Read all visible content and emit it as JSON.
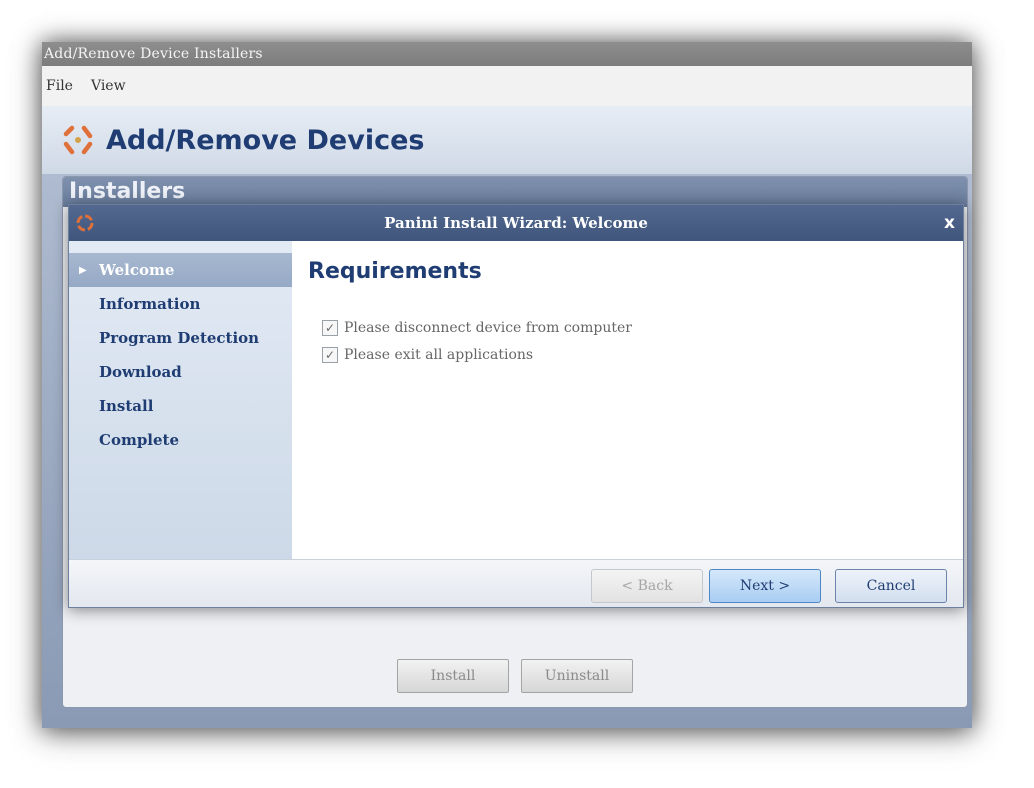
{
  "app": {
    "window_title": "Add/Remove Device Installers",
    "menu": [
      "File",
      "View"
    ],
    "header_title": "Add/Remove Devices",
    "panel_title": "Installers",
    "footer_buttons": {
      "install": "Install",
      "uninstall": "Uninstall"
    }
  },
  "wizard": {
    "title": "Panini Install Wizard: Welcome",
    "close_label": "x",
    "steps": [
      {
        "label": "Welcome",
        "active": true
      },
      {
        "label": "Information"
      },
      {
        "label": "Program Detection"
      },
      {
        "label": "Download"
      },
      {
        "label": "Install"
      },
      {
        "label": "Complete"
      }
    ],
    "content": {
      "heading": "Requirements",
      "requirements": [
        {
          "label": "Please disconnect device from computer",
          "checked": true
        },
        {
          "label": "Please exit all applications",
          "checked": true
        }
      ]
    },
    "buttons": {
      "back": "< Back",
      "next": "Next >",
      "cancel": "Cancel"
    }
  },
  "colors": {
    "accent_blue": "#1f3d73",
    "title_bar": "#4a5f86",
    "logo_orange": "#e0703a"
  }
}
